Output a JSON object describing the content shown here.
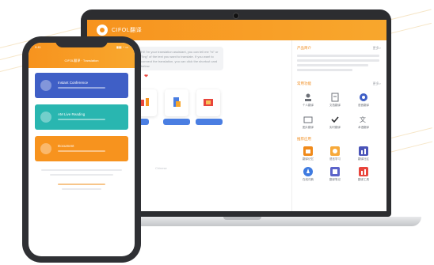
{
  "laptop": {
    "app_title": "CIFOL翻译",
    "chat_text": "Hi! I'm your translation assistant, you can tell me \"hi\" or \"ling\" of the text you want to translate. If you want to connect the translation, you can click the shortcut card below.",
    "input_hint": "Chinese",
    "card_buttons": [
      "",
      "",
      ""
    ],
    "panel": {
      "section1_title": "产品简介",
      "section1_more": "更多>",
      "section2_title": "常用功能",
      "section2_more": "更多>",
      "section3_title": "推荐应用",
      "row1_labels": [
        "个人翻译",
        "文档翻译",
        "语音翻译"
      ],
      "row2_labels": [
        "图片翻译",
        "实时翻译",
        "术语翻译"
      ],
      "row3_labels": [
        "翻译记忆",
        "语言学习",
        "翻译社区"
      ],
      "row4_labels": [
        "在线词典",
        "翻译笔记",
        "翻译工具"
      ]
    }
  },
  "phone": {
    "time": "9:41",
    "status": "▮▮▮ ◔ ▭",
    "title": "CIFOL翻译 · Translation",
    "cards": [
      {
        "label": "Instant Conference",
        "color": "#3f5fc6"
      },
      {
        "label": "AM Live Reading",
        "color": "#29b6b0"
      },
      {
        "label": "Document",
        "color": "#f7931e"
      }
    ]
  },
  "colors": {
    "accent_orange": "#f7931e",
    "blue": "#3f5fc6",
    "teal": "#29b6b0",
    "device_dark": "#2f3034"
  }
}
